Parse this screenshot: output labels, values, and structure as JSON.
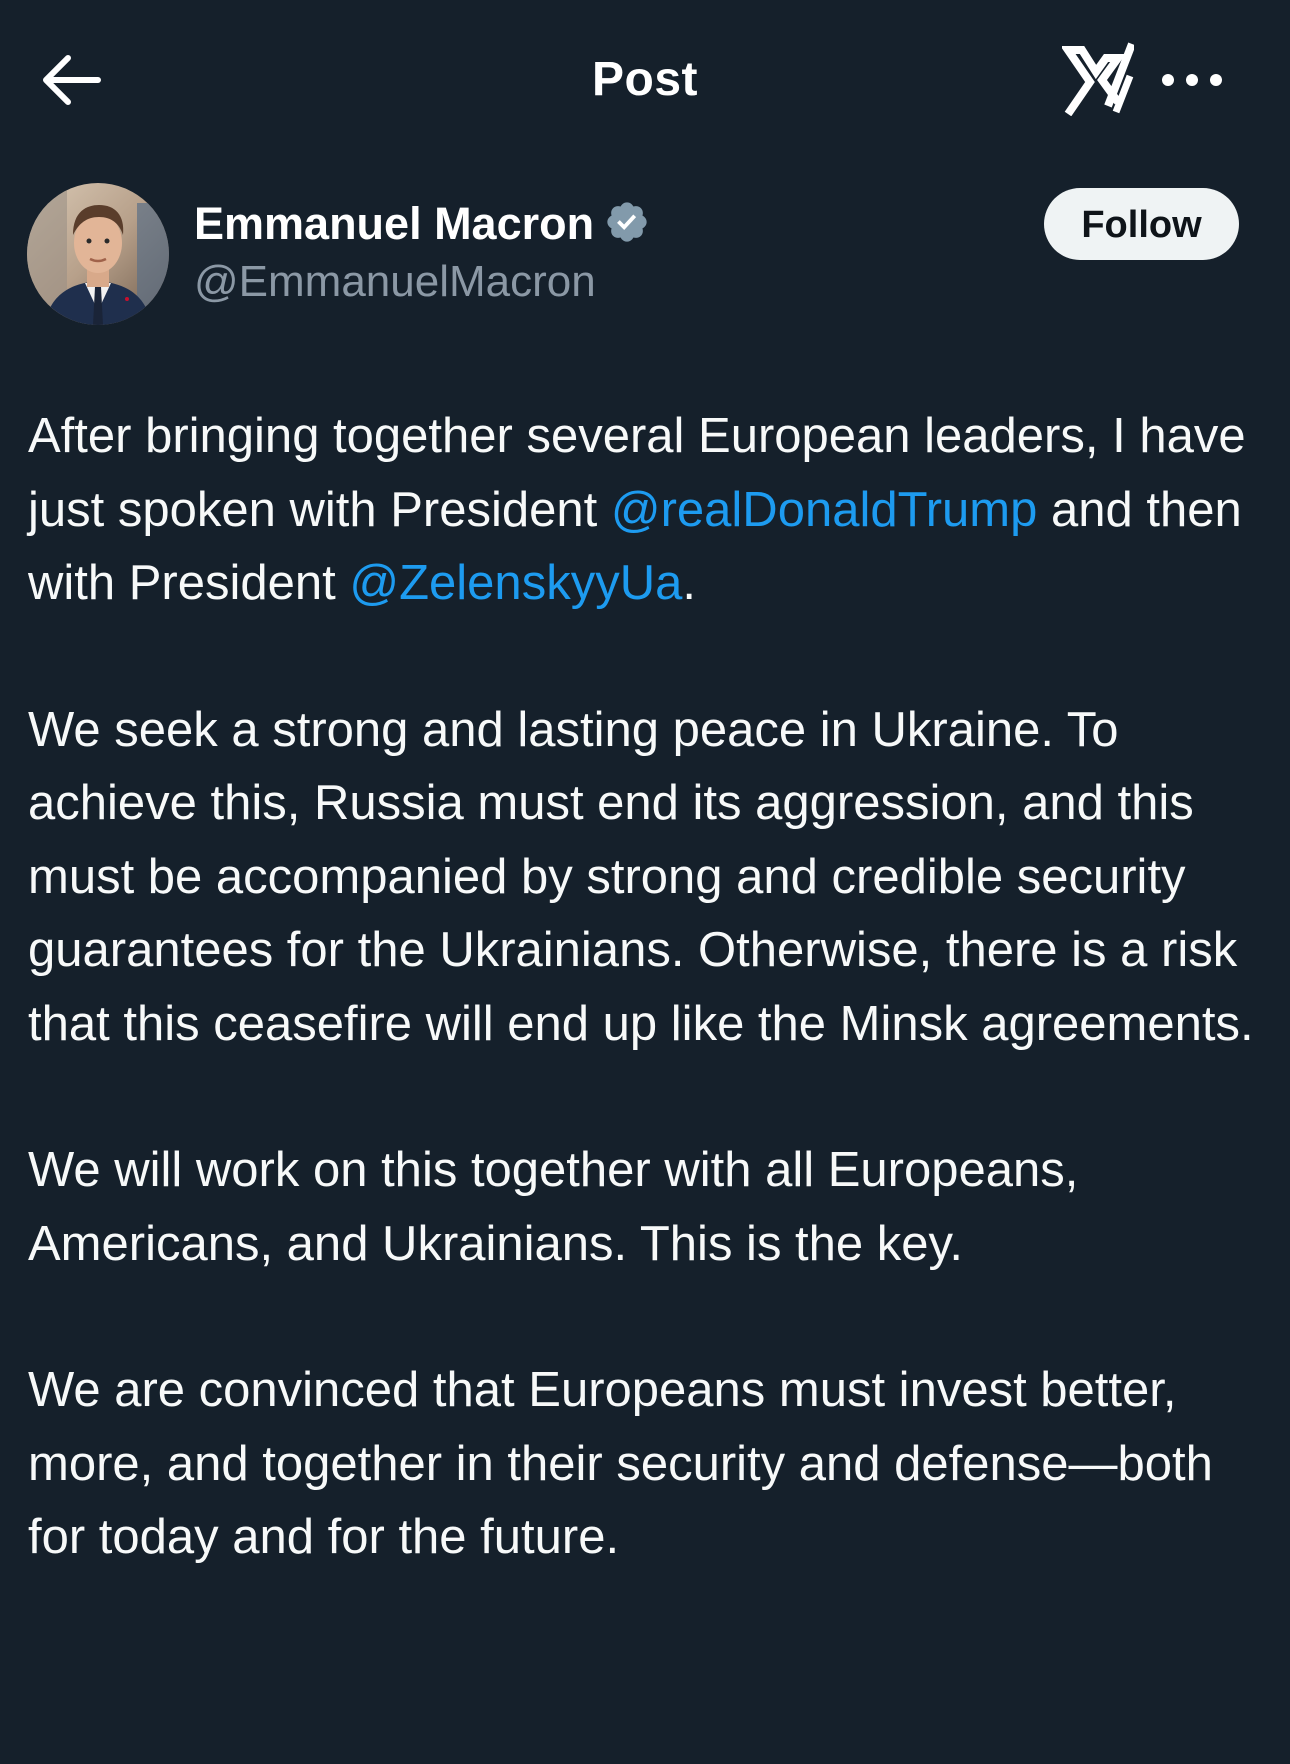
{
  "header": {
    "title": "Post",
    "back_icon": "arrow-left-icon",
    "grok_icon": "grok-icon",
    "more_icon": "more-horizontal-icon"
  },
  "author": {
    "display_name": "Emmanuel Macron",
    "handle": "@EmmanuelMacron",
    "verified_icon": "verified-badge-icon",
    "verified_color": "#829aab",
    "follow_label": "Follow"
  },
  "post": {
    "p1": {
      "text_before": "After bringing together several European leaders, I have just spoken with President ",
      "mention1": "@realDonaldTrump",
      "text_middle": " and then with President ",
      "mention2": "@ZelenskyyUa",
      "text_after": "."
    },
    "p2": "We seek a strong and lasting peace in Ukraine. To achieve this, Russia must end its aggression, and this must be accompanied by strong and credible security guarantees for the Ukrainians. Otherwise, there is a risk that this ceasefire will end up like the Minsk agreements.",
    "p3": "We will work on this together with all Europeans, Americans, and Ukrainians. This is the key.",
    "p4": "We are convinced that Europeans must invest better, more, and together in their security and defense—both for today and for the future."
  },
  "colors": {
    "background": "#15202b",
    "mention": "#1d9bf0",
    "secondary_text": "#8b98a5",
    "follow_bg": "#eff3f4"
  }
}
